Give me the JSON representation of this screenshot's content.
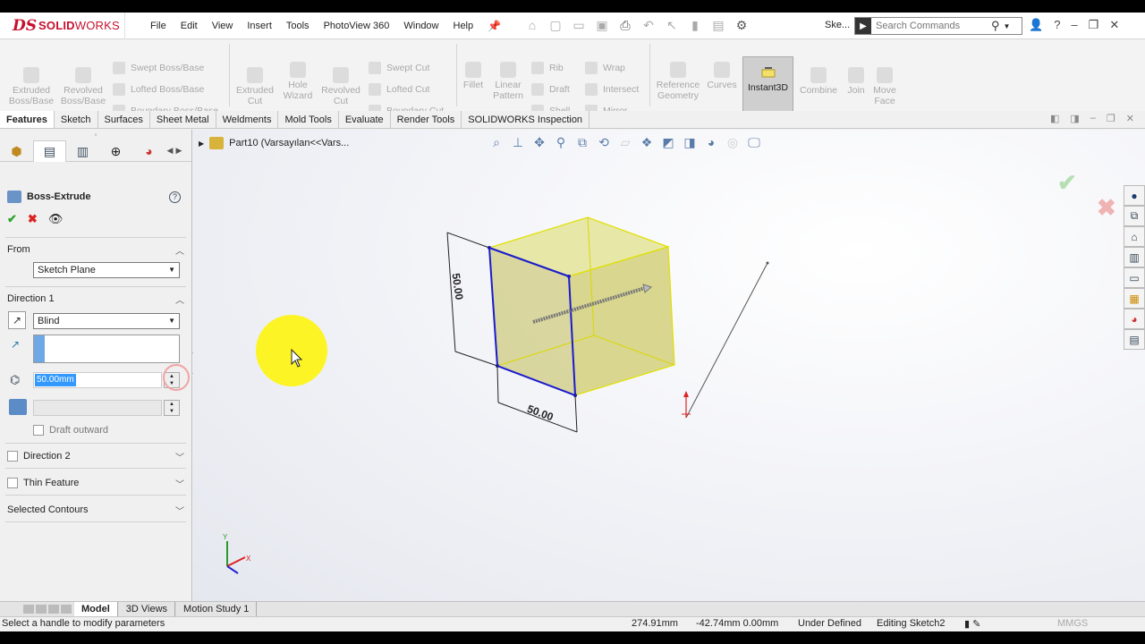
{
  "app": {
    "logo_ds": "DS",
    "logo_solid": "SOLID",
    "logo_works": "WORKS"
  },
  "menu": [
    "File",
    "Edit",
    "View",
    "Insert",
    "Tools",
    "PhotoView 360",
    "Window",
    "Help"
  ],
  "doc_short": "Ske...",
  "search": {
    "placeholder": "Search Commands"
  },
  "toolbar": {
    "extruded_boss": "Extruded\nBoss/Base",
    "revolved_boss": "Revolved\nBoss/Base",
    "swept_boss": "Swept Boss/Base",
    "lofted_boss": "Lofted Boss/Base",
    "boundary_boss": "Boundary Boss/Base",
    "extruded_cut": "Extruded\nCut",
    "hole_wizard": "Hole\nWizard",
    "revolved_cut": "Revolved\nCut",
    "swept_cut": "Swept Cut",
    "lofted_cut": "Lofted Cut",
    "boundary_cut": "Boundary Cut",
    "fillet": "Fillet",
    "linear_pattern": "Linear\nPattern",
    "rib": "Rib",
    "draft": "Draft",
    "shell": "Shell",
    "wrap": "Wrap",
    "intersect": "Intersect",
    "mirror": "Mirror",
    "reference_geometry": "Reference\nGeometry",
    "curves": "Curves",
    "instant3d": "Instant3D",
    "combine": "Combine",
    "join": "Join",
    "move_face": "Move\nFace"
  },
  "tabs": [
    "Features",
    "Sketch",
    "Surfaces",
    "Sheet Metal",
    "Weldments",
    "Mold Tools",
    "Evaluate",
    "Render Tools",
    "SOLIDWORKS Inspection"
  ],
  "property_manager": {
    "title": "Boss-Extrude",
    "help": "?",
    "from_label": "From",
    "from_value": "Sketch Plane",
    "direction1_label": "Direction 1",
    "end_condition": "Blind",
    "depth": "50.00mm",
    "draft_outward": "Draft outward",
    "direction2_label": "Direction 2",
    "thin_feature_label": "Thin Feature",
    "selected_contours_label": "Selected Contours"
  },
  "graphics": {
    "tree_item": "Part10  (Varsayılan<<Vars...",
    "dim_vertical": "50.00",
    "dim_horizontal": "50.00",
    "triad_y": "Y",
    "triad_x": "X"
  },
  "bottom_tabs": [
    "Model",
    "3D Views",
    "Motion Study 1"
  ],
  "status": {
    "message": "Select a handle to modify parameters",
    "x": "274.91mm",
    "y": "-42.74mm  0.00mm",
    "definition": "Under Defined",
    "editing": "Editing Sketch2",
    "units": "MMGS"
  },
  "colors": {
    "brand": "#c8102e",
    "sketch_blue": "#1a1acc",
    "preview_yellow": "#e6e680",
    "highlight": "#fff500"
  }
}
